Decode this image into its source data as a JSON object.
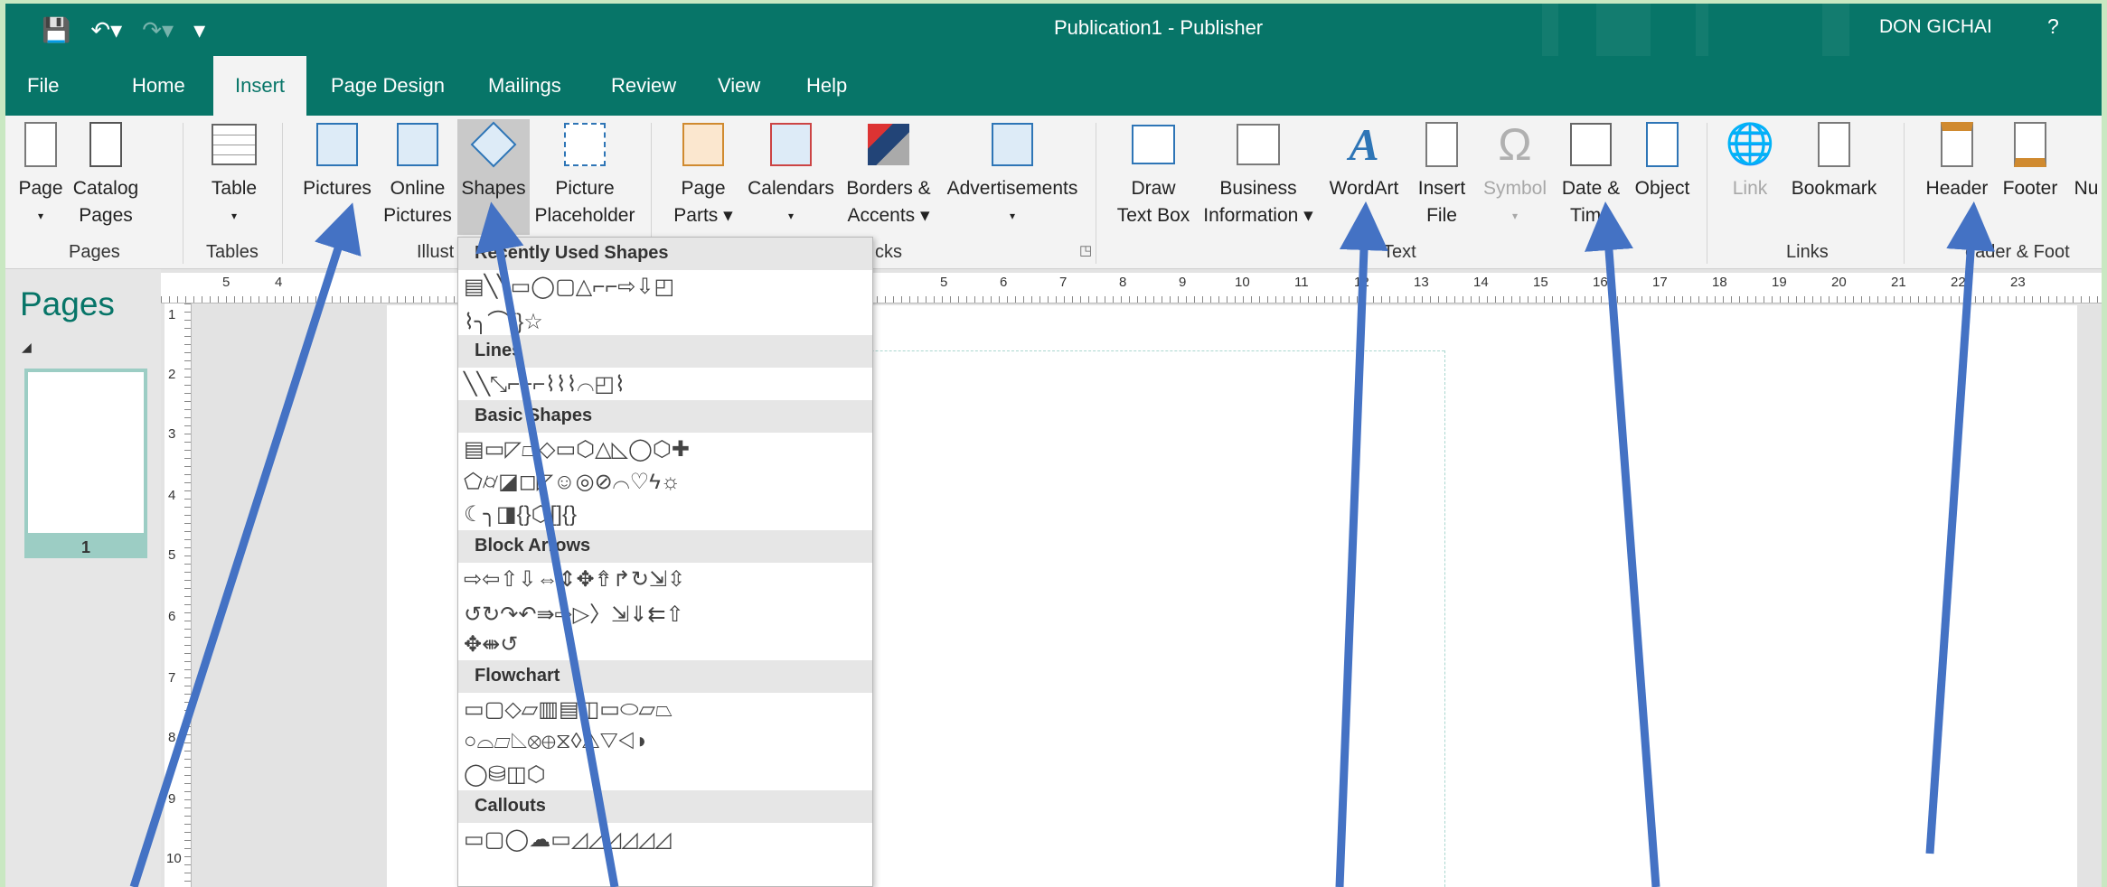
{
  "window": {
    "title": "Publication1  -  Publisher",
    "user": "DON GICHAI",
    "help": "?",
    "qat": {
      "save_icon": "💾",
      "undo_icon": "↶▾",
      "redo_icon": "↷▾",
      "customize_icon": "▾"
    }
  },
  "tabs": [
    "File",
    "Home",
    "Insert",
    "Page Design",
    "Mailings",
    "Review",
    "View",
    "Help"
  ],
  "active_tab": "Insert",
  "ribbon": {
    "page": [
      "Page",
      "▾"
    ],
    "catalog": [
      "Catalog",
      "Pages"
    ],
    "table": [
      "Table",
      "▾"
    ],
    "pictures": [
      "Pictures",
      ""
    ],
    "online_pictures": [
      "Online",
      "Pictures"
    ],
    "shapes": [
      "Shapes",
      "▾"
    ],
    "picture_placeholder": [
      "Picture",
      "Placeholder"
    ],
    "page_parts": [
      "Page",
      "Parts ▾"
    ],
    "calendars": [
      "Calendars",
      "▾"
    ],
    "borders": [
      "Borders &",
      "Accents ▾"
    ],
    "advertisements": [
      "Advertisements",
      "▾"
    ],
    "draw_text_box": [
      "Draw",
      "Text Box"
    ],
    "business_info": [
      "Business",
      "Information ▾"
    ],
    "wordart": [
      "WordArt",
      "▾"
    ],
    "insert_file": [
      "Insert",
      "File"
    ],
    "symbol": [
      "Symbol",
      "▾"
    ],
    "date_time": [
      "Date &",
      "Time"
    ],
    "object": [
      "Object",
      ""
    ],
    "link": [
      "Link",
      ""
    ],
    "bookmark": [
      "Bookmark",
      ""
    ],
    "header": [
      "Header",
      ""
    ],
    "footer": [
      "Footer",
      ""
    ],
    "page_number_partial": [
      "",
      "Nu"
    ],
    "groups": {
      "pages": "Pages",
      "tables": "Tables",
      "illustrations": "Illust",
      "building_blocks": "cks",
      "text": "Text",
      "links": "Links",
      "header_footer": "eader & Foot"
    }
  },
  "pages_pane": {
    "title": "Pages",
    "page_number": "1"
  },
  "ruler": {
    "h_numbers": [
      "5",
      "4",
      "5",
      "6",
      "7",
      "8",
      "9",
      "10",
      "11",
      "12",
      "13",
      "14",
      "15",
      "16",
      "17",
      "18",
      "19",
      "20",
      "21",
      "22",
      "23"
    ],
    "v_numbers": [
      "1",
      "2",
      "3",
      "4",
      "5",
      "6",
      "7",
      "8",
      "9",
      "10"
    ]
  },
  "shapes_gallery": {
    "sections": [
      {
        "title": "Recently Used Shapes",
        "rows": [
          "▤╲╲▭◯▢△⌐⌐⇨⇩◰",
          "⌇╮⌒{}☆"
        ]
      },
      {
        "title": "Lines",
        "rows": [
          "╲╲⤡⌐⌐⌐⌇⌇⌇⌒◰⌇"
        ]
      },
      {
        "title": "Basic Shapes",
        "rows": [
          "▤▭◸⏢◇▭⬡△◺◯⬡✚",
          "⬠⌭◪◻◸☺◎⊘⌒♡ϟ☼",
          "☾╮◨{}⬡[]{}"
        ]
      },
      {
        "title": "Block Arrows",
        "rows": [
          "⇨⇦⇧⇩⇔⇕✥⇮↱↻⇲⇳",
          "↺↻↷↶⇛⇨▷〉⇲⇓⇇⇧",
          "✥⇼↺"
        ]
      },
      {
        "title": "Flowchart",
        "rows": [
          "▭▢◇▱▥▤◫▭⬭▱⏢",
          "○⌓▱◺⊗⊕⧖◊△▽◁◗",
          "◯⛁◫⬡"
        ]
      },
      {
        "title": "Callouts",
        "rows": [
          "▭▢◯☁▭◿◿◿◿◿◿"
        ]
      }
    ]
  },
  "annotation": {
    "arrow_color": "#4472c4"
  },
  "colors": {
    "theme": "#077568",
    "accent_tab_text": "#077568",
    "frame": "#c9e8c2"
  }
}
